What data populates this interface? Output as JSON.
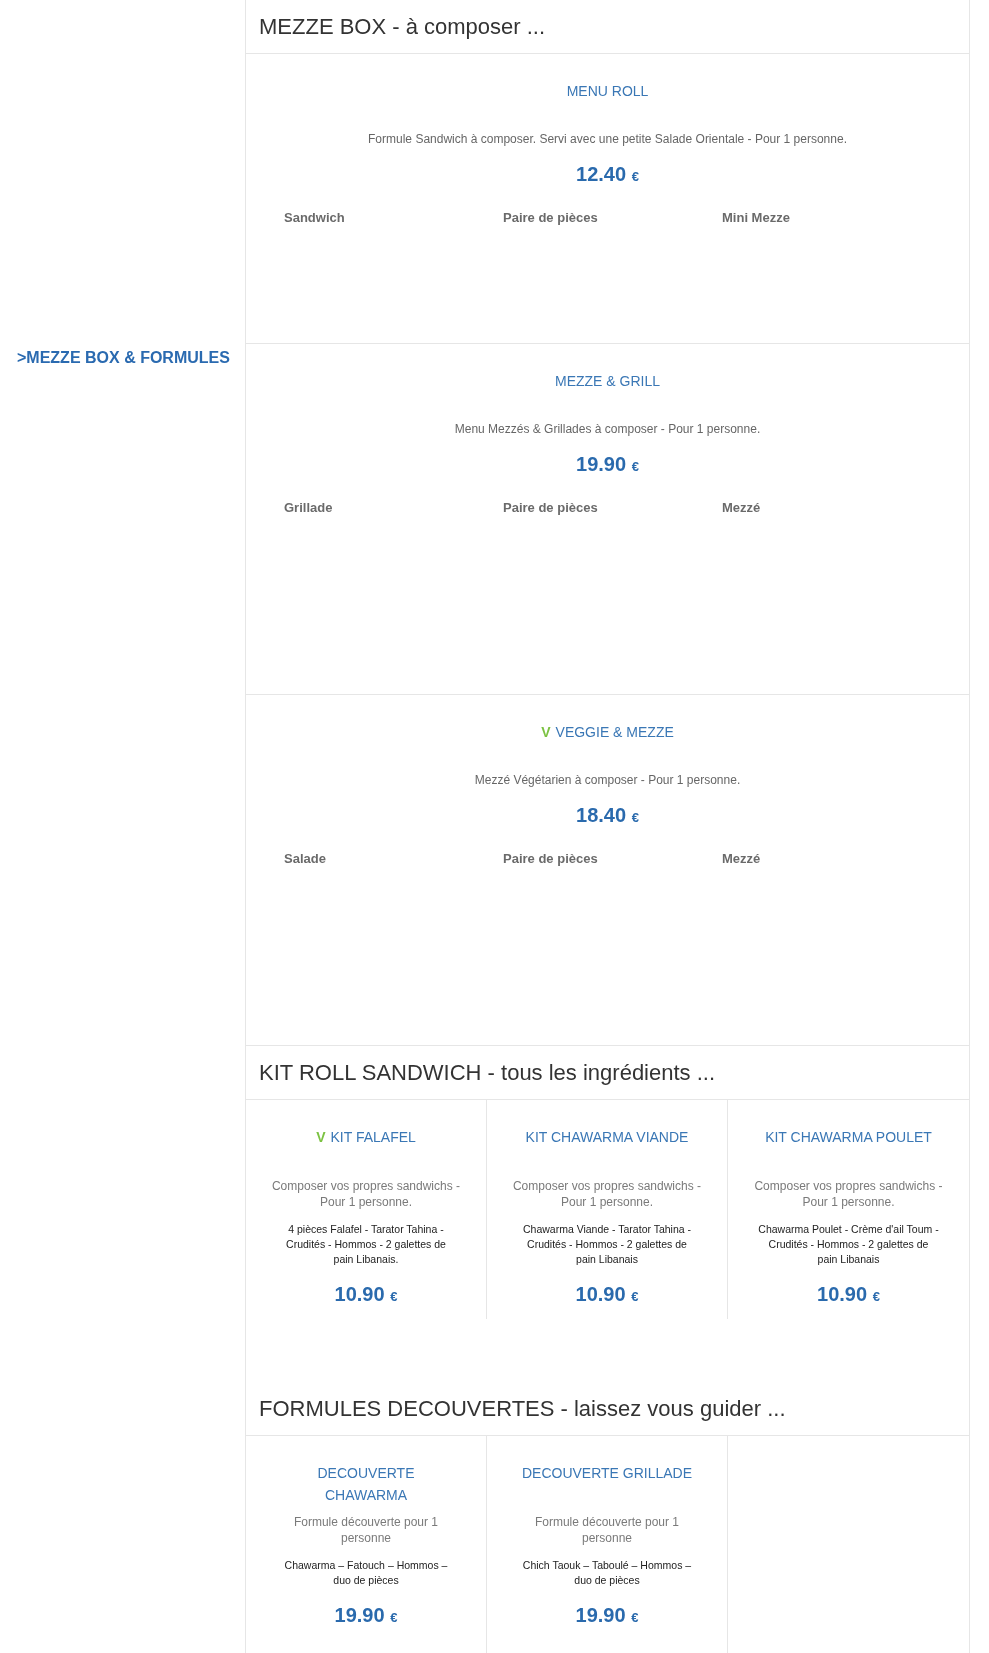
{
  "sidebar": {
    "category": ">MEZZE BOX & FORMULES"
  },
  "sections": [
    {
      "title": "MEZZE BOX - à composer ...",
      "kind": "list",
      "items": [
        {
          "name": "MENU ROLL",
          "description": "Formule Sandwich à composer. Servi avec une petite Salade Orientale - Pour 1 personne.",
          "price": "12.40",
          "currency": "€",
          "options": [
            "Sandwich",
            "Paire de pièces",
            "Mini Mezze"
          ]
        },
        {
          "name": "MEZZE & GRILL",
          "description": "Menu Mezzés & Grillades à composer - Pour 1 personne.",
          "price": "19.90",
          "currency": "€",
          "options": [
            "Grillade",
            "Paire de pièces",
            "Mezzé"
          ]
        },
        {
          "veggie_mark": "V",
          "name": "VEGGIE & MEZZE",
          "description": "Mezzé Végétarien à composer - Pour 1 personne.",
          "price": "18.40",
          "currency": "€",
          "options": [
            "Salade",
            "Paire de pièces",
            "Mezzé"
          ]
        }
      ]
    },
    {
      "title": "KIT ROLL SANDWICH - tous les ingrédients ...",
      "kind": "grid",
      "items": [
        {
          "veggie_mark": "V",
          "name": "KIT FALAFEL",
          "description": "Composer vos propres sandwichs - Pour 1 personne.",
          "ingredients": "4 pièces Falafel - Tarator Tahina - Crudités - Hommos - 2 galettes de pain Libanais.",
          "price": "10.90",
          "currency": "€"
        },
        {
          "name": "KIT CHAWARMA VIANDE",
          "description": "Composer vos propres sandwichs - Pour 1 personne.",
          "ingredients": "Chawarma Viande - Tarator Tahina - Crudités - Hommos - 2 galettes de pain Libanais",
          "price": "10.90",
          "currency": "€"
        },
        {
          "name": "KIT CHAWARMA POULET",
          "description": "Composer vos propres sandwichs - Pour 1 personne.",
          "ingredients": "Chawarma Poulet - Crème d'ail Toum - Crudités - Hommos - 2 galettes de pain Libanais",
          "price": "10.90",
          "currency": "€"
        }
      ]
    },
    {
      "title": "FORMULES DECOUVERTES - laissez vous guider ...",
      "kind": "grid",
      "items": [
        {
          "name": "DECOUVERTE CHAWARMA",
          "description": "Formule découverte pour 1 personne",
          "ingredients": "Chawarma – Fatouch – Hommos – duo de pièces",
          "price": "19.90",
          "currency": "€"
        },
        {
          "name": "DECOUVERTE GRILLADE",
          "description": "Formule découverte pour 1 personne",
          "ingredients": "Chich Taouk – Taboulé – Hommos – duo de pièces",
          "price": "19.90",
          "currency": "€"
        }
      ]
    }
  ]
}
